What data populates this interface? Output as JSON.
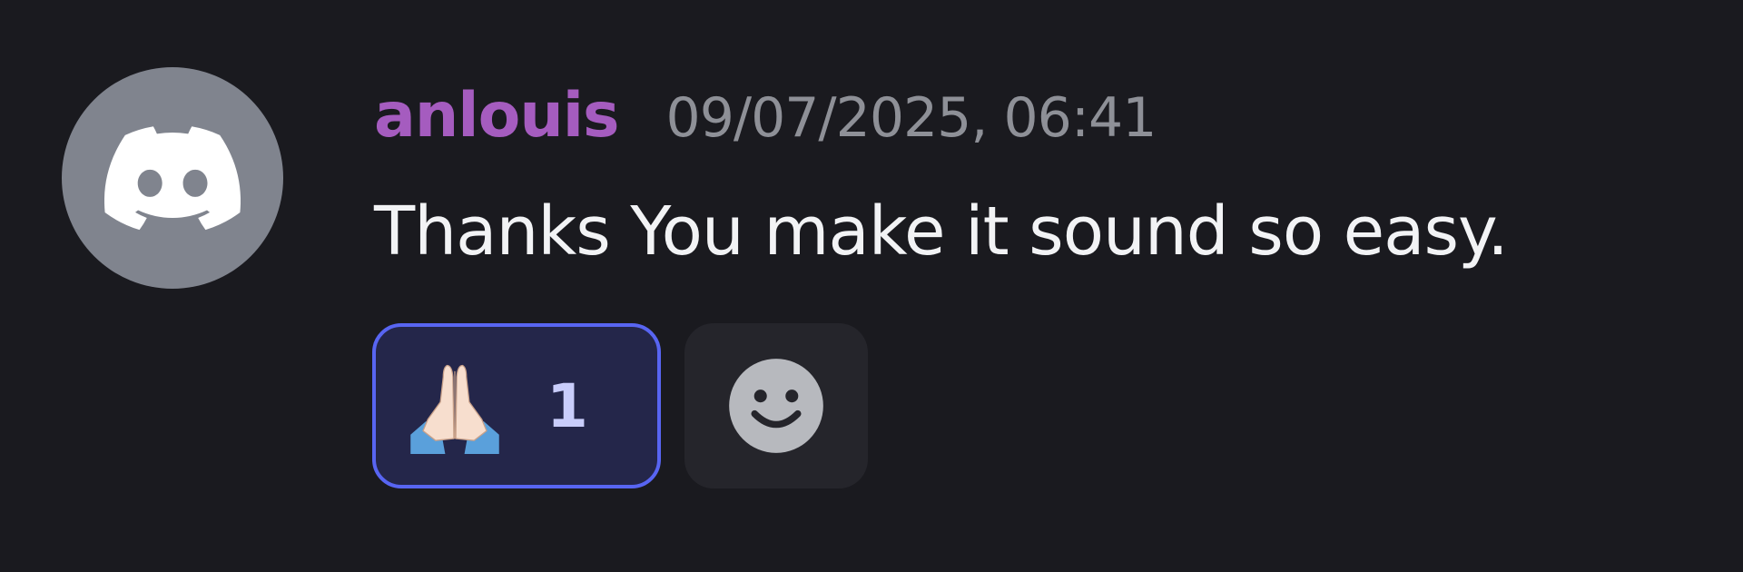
{
  "message": {
    "author": {
      "username": "anlouis",
      "avatar_icon": "discord-logo-icon",
      "username_color": "#a55cbf"
    },
    "timestamp": "09/07/2025, 06:41",
    "content": "Thanks You make it sound so easy.",
    "reactions": [
      {
        "emoji_icon": "folded-hands-emoji",
        "count": "1",
        "reacted_by_me": true
      }
    ],
    "add_reaction_icon": "smiley-face-icon"
  },
  "colors": {
    "background": "#1a1a1f",
    "avatar_background": "#80848e",
    "reaction_accent": "#5865f2",
    "timestamp": "#8e9097",
    "text": "#f2f3f5"
  }
}
